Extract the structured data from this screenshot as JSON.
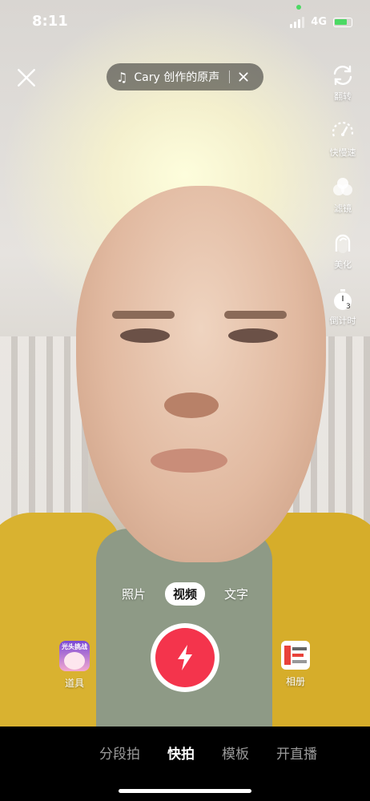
{
  "status_bar": {
    "time": "8:11",
    "network": "4G"
  },
  "top": {
    "music_title": "Cary 创作的原声"
  },
  "tools": [
    {
      "icon": "flip-icon",
      "label": "翻转"
    },
    {
      "icon": "speed-icon",
      "label": "快慢速"
    },
    {
      "icon": "filter-icon",
      "label": "滤镜"
    },
    {
      "icon": "beauty-icon",
      "label": "美化"
    },
    {
      "icon": "timer-icon",
      "label": "倒计时"
    }
  ],
  "modes": [
    "照片",
    "视频",
    "文字"
  ],
  "active_mode": "视频",
  "props": {
    "label": "道具",
    "thumb_text": "光头挑战"
  },
  "album": {
    "label": "相册"
  },
  "tabs": [
    "分段拍",
    "快拍",
    "模板",
    "开直播"
  ],
  "active_tab": "快拍",
  "colors": {
    "shutter": "#f4344c",
    "accent_green": "#4cd964"
  }
}
